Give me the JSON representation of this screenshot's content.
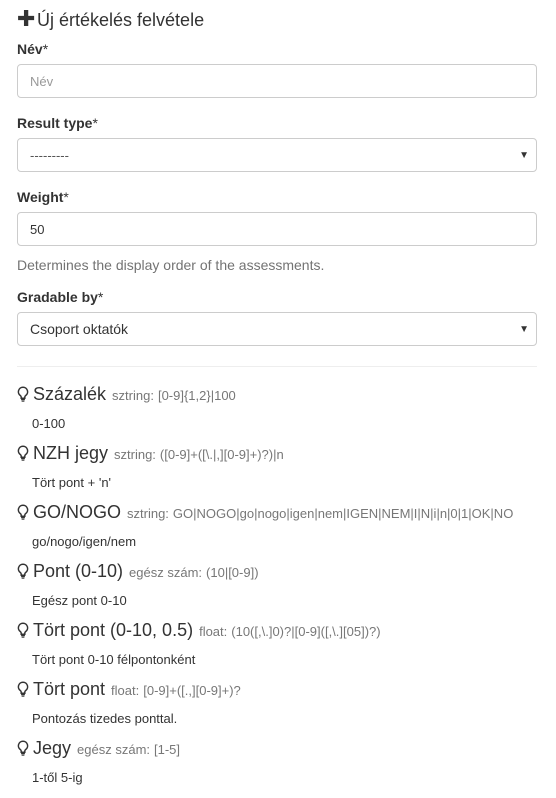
{
  "header": {
    "title": "Új értékelés felvétele",
    "icon": "plus-icon"
  },
  "form": {
    "name": {
      "label": "Név",
      "required_mark": "*",
      "placeholder": "Név",
      "value": ""
    },
    "result_type": {
      "label": "Result type",
      "required_mark": "*",
      "selected": "---------"
    },
    "weight": {
      "label": "Weight",
      "required_mark": "*",
      "value": "50",
      "help": "Determines the display order of the assessments."
    },
    "gradable_by": {
      "label": "Gradable by",
      "required_mark": "*",
      "selected": "Csoport oktatók"
    }
  },
  "result_types": [
    {
      "name": "Százalék",
      "kind": "sztring:",
      "regex": "[0-9]{1,2}|100",
      "description": "0-100"
    },
    {
      "name": "NZH jegy",
      "kind": "sztring:",
      "regex": "([0-9]+([\\.|,][0-9]+)?)|n",
      "description": "Tört pont + 'n'"
    },
    {
      "name": "GO/NOGO",
      "kind": "sztring:",
      "regex": "GO|NOGO|go|nogo|igen|nem|IGEN|NEM|I|N|i|n|0|1|OK|NO",
      "description": "go/nogo/igen/nem"
    },
    {
      "name": "Pont (0-10)",
      "kind": "egész szám:",
      "regex": "(10|[0-9])",
      "description": "Egész pont 0-10"
    },
    {
      "name": "Tört pont (0-10, 0.5)",
      "kind": "float:",
      "regex": "(10([,\\.]0)?|[0-9]([,\\.][05])?)",
      "description": "Tört pont 0-10 félpontonként"
    },
    {
      "name": "Tört pont",
      "kind": "float:",
      "regex": "[0-9]+([.,][0-9]+)?",
      "description": "Pontozás tizedes ponttal."
    },
    {
      "name": "Jegy",
      "kind": "egész szám:",
      "regex": "[1-5]",
      "description": "1-től 5-ig"
    }
  ],
  "icons": {
    "result_type_icon": "lightbulb-icon",
    "select_caret": "caret-down-icon"
  }
}
